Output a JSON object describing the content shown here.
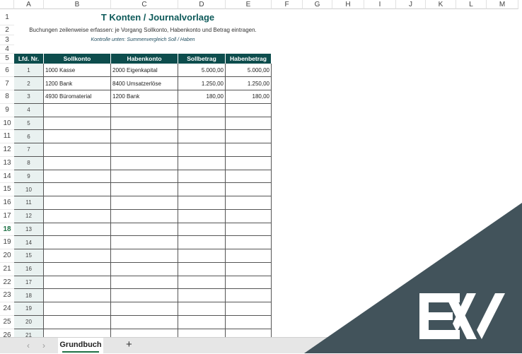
{
  "columns": [
    "A",
    "B",
    "C",
    "D",
    "E",
    "F",
    "G",
    "H",
    "I",
    "J",
    "K",
    "L",
    "M"
  ],
  "title": "T Konten / Journalvorlage",
  "subtitle": "Buchungen zeilenweise erfassen: je Vorgang Sollkonto, Habenkonto und Betrag eintragen.",
  "note": "Kontrolle unten: Summenvergleich Soll / Haben",
  "headers": [
    "Lfd. Nr.",
    "Sollkonto",
    "Habenkonto",
    "Sollbetrag",
    "Habenbetrag"
  ],
  "rows": [
    [
      "1",
      "1000 Kasse",
      "2000 Eigenkapital",
      "5.000,00",
      "5.000,00"
    ],
    [
      "2",
      "1200 Bank",
      "8400 Umsatzerlöse",
      "1.250,00",
      "1.250,00"
    ],
    [
      "3",
      "4930 Büromaterial",
      "1200 Bank",
      "180,00",
      "180,00"
    ],
    [
      "4",
      "",
      "",
      "",
      ""
    ],
    [
      "5",
      "",
      "",
      "",
      ""
    ],
    [
      "6",
      "",
      "",
      "",
      ""
    ],
    [
      "7",
      "",
      "",
      "",
      ""
    ],
    [
      "8",
      "",
      "",
      "",
      ""
    ],
    [
      "9",
      "",
      "",
      "",
      ""
    ],
    [
      "10",
      "",
      "",
      "",
      ""
    ],
    [
      "11",
      "",
      "",
      "",
      ""
    ],
    [
      "12",
      "",
      "",
      "",
      ""
    ],
    [
      "13",
      "",
      "",
      "",
      ""
    ],
    [
      "14",
      "",
      "",
      "",
      ""
    ],
    [
      "15",
      "",
      "",
      "",
      ""
    ],
    [
      "16",
      "",
      "",
      "",
      ""
    ],
    [
      "17",
      "",
      "",
      "",
      ""
    ],
    [
      "18",
      "",
      "",
      "",
      ""
    ],
    [
      "19",
      "",
      "",
      "",
      ""
    ],
    [
      "20",
      "",
      "",
      "",
      ""
    ],
    [
      "21",
      "",
      "",
      "",
      ""
    ]
  ],
  "active_row": "18",
  "sheet_tab": "Grundbuch",
  "add_sheet": "+",
  "nav_prev": "‹",
  "nav_next": "›",
  "colors": {
    "header_bg": "#0d4d4d",
    "title": "#0e5a5a",
    "brand_triangle": "#42535b"
  },
  "logo": "EV"
}
